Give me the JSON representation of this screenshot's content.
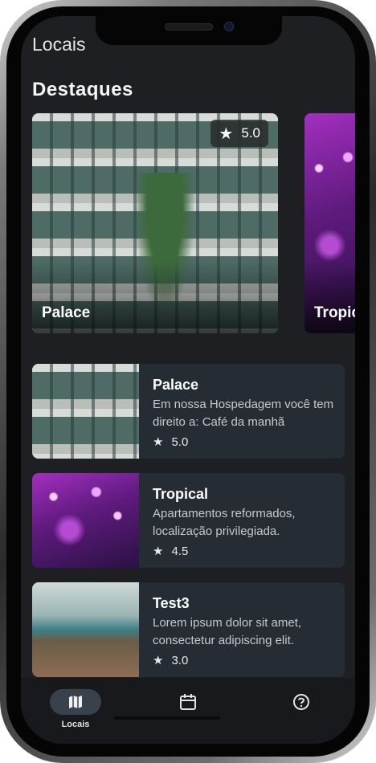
{
  "app": {
    "title": "Locais"
  },
  "section": {
    "title": "Destaques"
  },
  "featured": [
    {
      "name": "Palace",
      "rating": "5.0"
    },
    {
      "name": "Tropic"
    }
  ],
  "places": [
    {
      "name": "Palace",
      "description": "Em nossa Hospedagem você tem direito a: Café da manhã",
      "rating": "5.0"
    },
    {
      "name": "Tropical",
      "description": "Apartamentos reformados, localização privilegiada.",
      "rating": "4.5"
    },
    {
      "name": "Test3",
      "description": "Lorem ipsum dolor sit amet, consectetur adipiscing elit.",
      "rating": "3.0"
    }
  ],
  "nav": {
    "items": [
      {
        "label": "Locais",
        "icon": "map-icon",
        "active": true
      },
      {
        "label": "",
        "icon": "calendar-icon",
        "active": false
      },
      {
        "label": "",
        "icon": "help-icon",
        "active": false
      }
    ]
  },
  "colors": {
    "background": "#1d1f22",
    "card": "#262c34",
    "nav_pill": "#39414d"
  }
}
